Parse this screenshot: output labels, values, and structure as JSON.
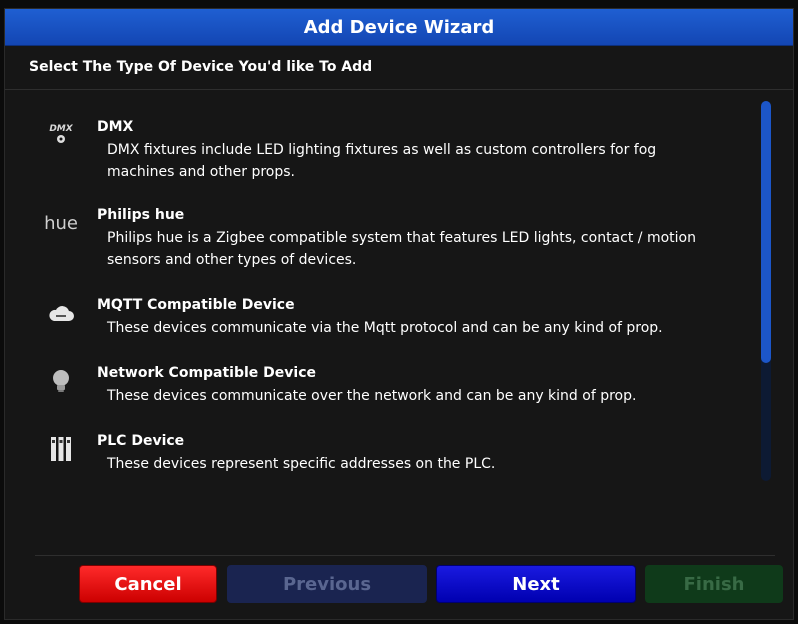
{
  "window": {
    "title": "Add Device Wizard"
  },
  "prompt": "Select The Type Of Device You'd like To Add",
  "device_types": [
    {
      "icon": "dmx-icon",
      "icon_text": "DMX",
      "name": "DMX",
      "description": "DMX fixtures include LED lighting fixtures as well as custom controllers for fog machines and other props."
    },
    {
      "icon": "hue-icon",
      "icon_text": "hue",
      "name": "Philips hue",
      "description": "Philips hue is a Zigbee compatible system that features LED lights, contact / motion sensors and other types of devices."
    },
    {
      "icon": "cloud-icon",
      "name": "MQTT Compatible Device",
      "description": "These devices communicate via the Mqtt protocol and can be any kind of prop."
    },
    {
      "icon": "lightbulb-icon",
      "name": "Network Compatible Device",
      "description": "These devices communicate over the network and can be any kind of prop."
    },
    {
      "icon": "plc-icon",
      "name": "PLC Device",
      "description": "These devices represent specific addresses on the PLC."
    }
  ],
  "buttons": {
    "cancel": "Cancel",
    "previous": "Previous",
    "next": "Next",
    "finish": "Finish"
  },
  "colors": {
    "title_bar": "#1f5fd2",
    "cancel": "#ff2a2a",
    "next": "#1a1ae0",
    "previous_disabled": "#1a2450",
    "finish_disabled": "#0f3a1a"
  }
}
